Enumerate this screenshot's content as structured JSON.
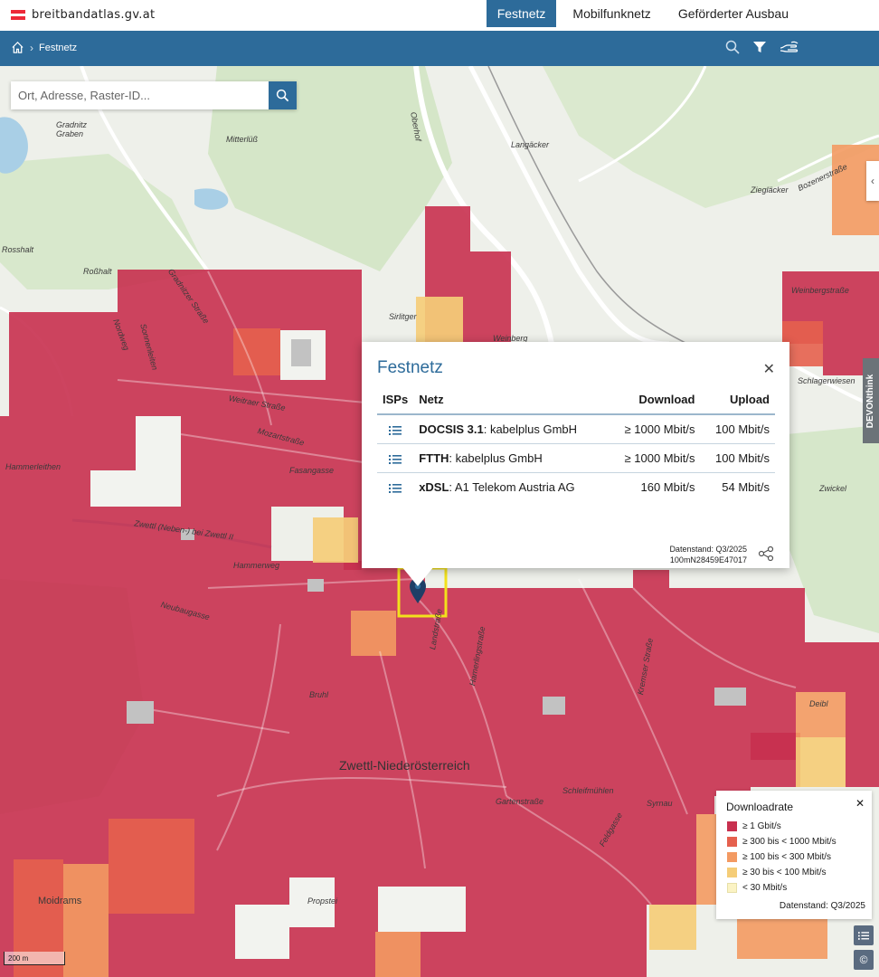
{
  "site": {
    "logo_text": "breitbandatlas.gv.at",
    "flag_colors": [
      "#ed2939",
      "#ffffff",
      "#ed2939"
    ]
  },
  "nav_tabs": [
    {
      "label": "Festnetz",
      "active": true
    },
    {
      "label": "Mobilfunknetz",
      "active": false
    },
    {
      "label": "Geförderter Ausbau",
      "active": false
    }
  ],
  "breadcrumb": {
    "current": "Festnetz"
  },
  "header_tools": {
    "search_icon": "search-icon",
    "filter_icon": "filter-icon",
    "hand_icon": "hand-icon"
  },
  "search": {
    "placeholder": "Ort, Adresse, Raster-ID..."
  },
  "popup": {
    "title": "Festnetz",
    "columns": {
      "isps": "ISPs",
      "netz": "Netz",
      "download": "Download",
      "upload": "Upload"
    },
    "rows": [
      {
        "tech": "DOCSIS 3.1",
        "provider": ": kabelplus GmbH",
        "download": "≥ 1000 Mbit/s",
        "upload": "100 Mbit/s"
      },
      {
        "tech": "FTTH",
        "provider": ": kabelplus GmbH",
        "download": "≥ 1000 Mbit/s",
        "upload": "100 Mbit/s"
      },
      {
        "tech": "xDSL",
        "provider": ": A1 Telekom Austria AG",
        "download": "160 Mbit/s",
        "upload": "54 Mbit/s"
      }
    ],
    "datenstand": "Datenstand: Q3/2025",
    "raster_id": "100mN28459E47017"
  },
  "legend": {
    "title": "Downloadrate",
    "items": [
      {
        "label": "≥ 1 Gbit/s",
        "color": "#c8304f"
      },
      {
        "label": "≥ 300 bis < 1000 Mbit/s",
        "color": "#e5604e"
      },
      {
        "label": "≥ 100 bis < 300 Mbit/s",
        "color": "#f39a62"
      },
      {
        "label": "≥ 30 bis < 100 Mbit/s",
        "color": "#f5cd78"
      },
      {
        "label": "< 30 Mbit/s",
        "color": "#fbf3c4"
      }
    ],
    "datenstand": "Datenstand: Q3/2025"
  },
  "scale": "200 m",
  "devon": "DEVONthink",
  "map_labels": [
    "Gradnitz Graben",
    "Mitterlüß",
    "Oberhof",
    "Langäcker",
    "Ziegläcker",
    "Bozenerstraße",
    "Rosshalt",
    "Roßhalt",
    "Gradnitzer Straße",
    "Nordweg",
    "Sonnenleiten",
    "Weitraer Straße",
    "Mozartstraße",
    "Fasangasse",
    "Hammerleithen",
    "Weinbergstraße",
    "Schlagerwiesen",
    "Zwickel",
    "Zwettl (Neben-) bei Zwettl II",
    "Hammerweg",
    "Neubaugasse",
    "Bruhl",
    "Zwettl-Niederösterreich",
    "Moidrams",
    "Propstei",
    "Landstraße",
    "Kremser Straße",
    "Schleifmühlen",
    "Feldgasse",
    "Syrnau",
    "Gartenstraße",
    "Hamerlingstraße",
    "Weinberg",
    "Weitraer Straße",
    "Deibl",
    "Sirlitger"
  ]
}
